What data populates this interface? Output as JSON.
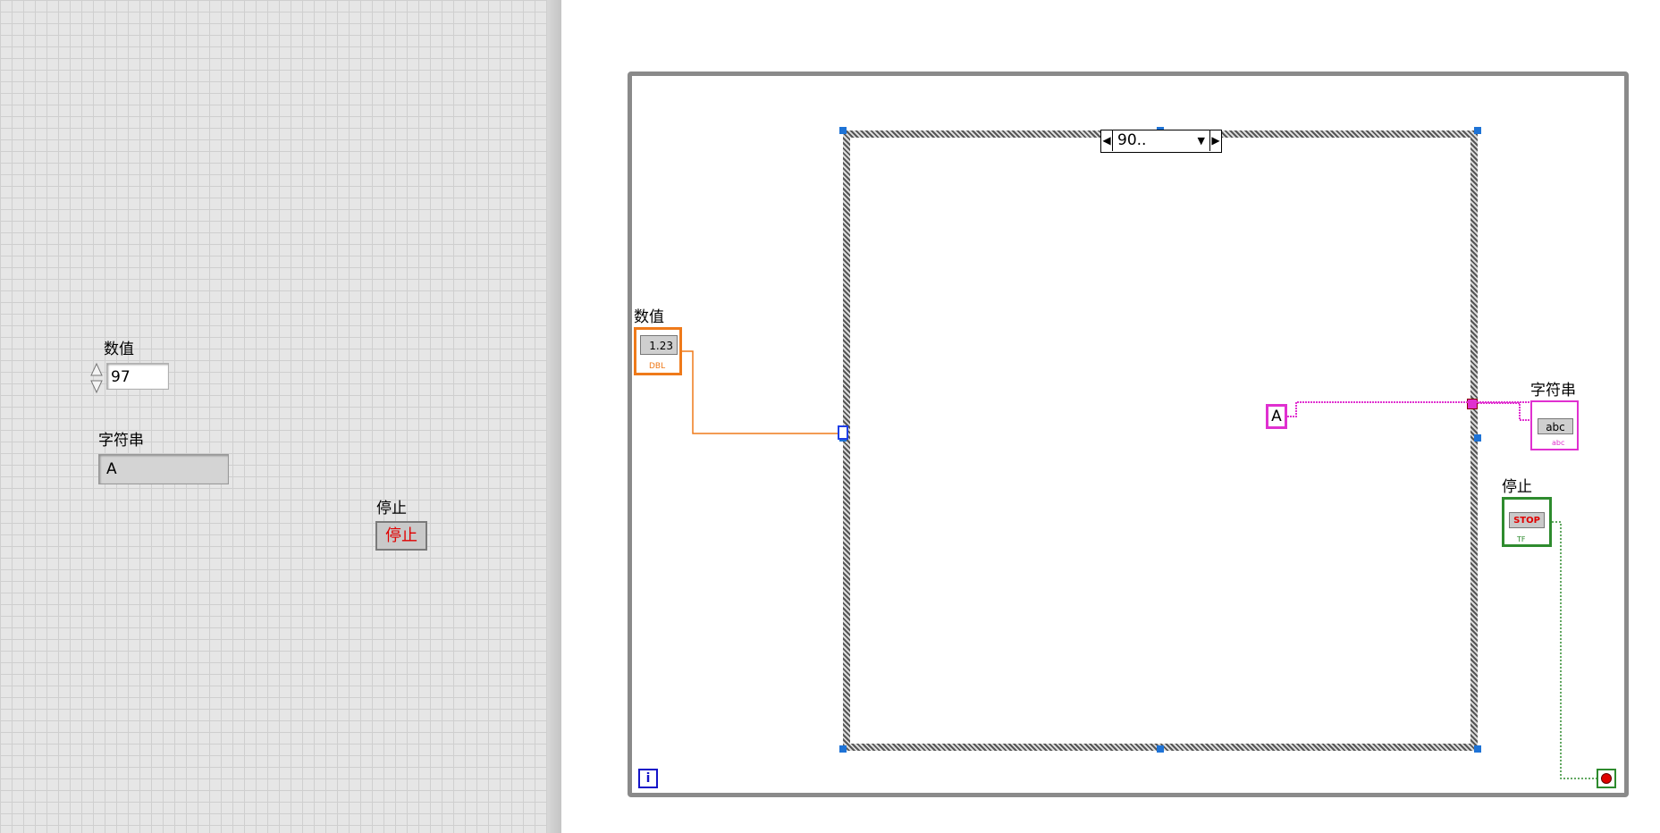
{
  "front_panel": {
    "numeric": {
      "label": "数值",
      "value": "97"
    },
    "string": {
      "label": "字符串",
      "value": "A"
    },
    "stop": {
      "label": "停止",
      "button_text": "停止"
    }
  },
  "block_diagram": {
    "numeric_terminal": {
      "label": "数值",
      "text": "1.23",
      "type": "DBL"
    },
    "string_terminal": {
      "label": "字符串",
      "text": "abc",
      "type": "abc"
    },
    "stop_terminal": {
      "label": "停止",
      "text": "STOP",
      "type": "TF"
    },
    "case_selector": {
      "value": "90.."
    },
    "string_constant": "A",
    "iteration_terminal": "i"
  },
  "colors": {
    "numeric_wire": "#ef7a1a",
    "string_wire": "#e030d0",
    "boolean_wire": "#2e8b2e",
    "stop_red": "#e00000"
  }
}
